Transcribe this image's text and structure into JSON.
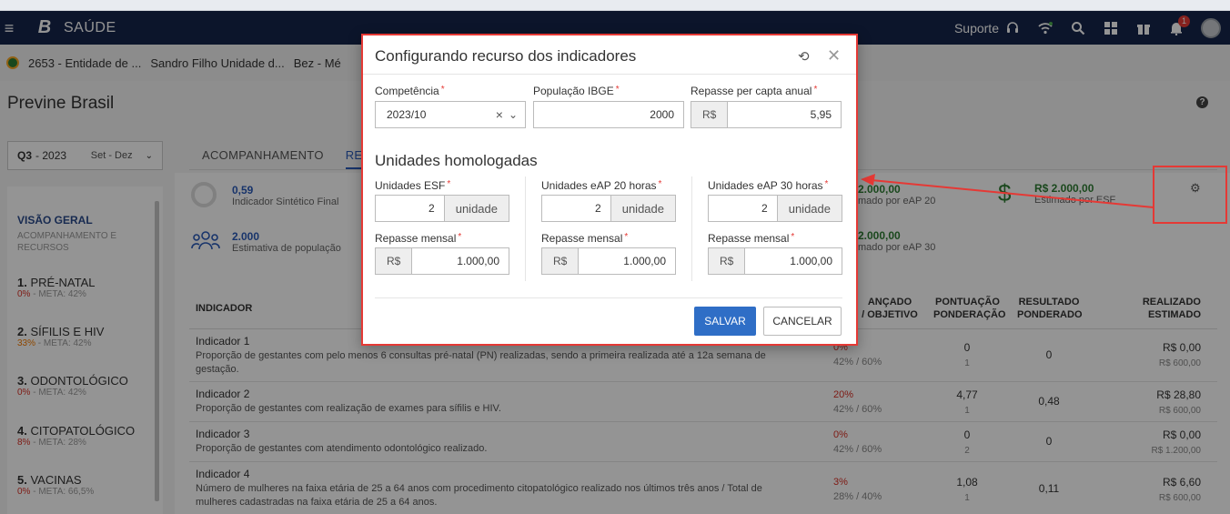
{
  "navbar": {
    "app_name": "SAÚDE",
    "support_label": "Suporte",
    "notification_count": "1"
  },
  "breadcrumb": {
    "entity": "2653 - Entidade de ...",
    "unit": "Sandro Filho Unidade d...",
    "extra": "Bez - Mé"
  },
  "page": {
    "title": "Previne Brasil"
  },
  "period": {
    "quarter": "Q3",
    "year": "- 2023",
    "range": "Set - Dez"
  },
  "sidenav": {
    "overview_title": "VISÃO GERAL",
    "overview_sub": "ACOMPANHAMENTO E RECURSOS",
    "items": [
      {
        "num": "1.",
        "label": "PRÉ-NATAL",
        "pct": "0%",
        "meta": " - META: 42%"
      },
      {
        "num": "2.",
        "label": "SÍFILIS E HIV",
        "pct": "33%",
        "meta": " - META: 42%"
      },
      {
        "num": "3.",
        "label": "ODONTOLÓGICO",
        "pct": "0%",
        "meta": " - META: 42%"
      },
      {
        "num": "4.",
        "label": "CITOPATOLÓGICO",
        "pct": "8%",
        "meta": " - META: 28%"
      },
      {
        "num": "5.",
        "label": "VACINAS",
        "pct": "0%",
        "meta": " - META: 66,5%"
      }
    ]
  },
  "tabs": [
    {
      "label": "ACOMPANHAMENTO"
    },
    {
      "label": "RECU"
    }
  ],
  "stats": {
    "isf_value": "0,59",
    "isf_label": "Indicador Sintético Final",
    "pop_value": "2.000",
    "pop_label": "Estimativa de população",
    "eap20_value": "2.000,00",
    "eap20_label": "mado por eAP 20",
    "eap30_value": "2.000,00",
    "eap30_label": "mado por eAP 30",
    "esf_value": "R$ 2.000,00",
    "esf_label": "Estimado por ESF"
  },
  "table": {
    "headers": {
      "indicador": "INDICADOR",
      "alcancado_1": "ANÇADO",
      "alcancado_2": "/ OBJETIVO",
      "pontuacao_1": "PONTUAÇÃO",
      "pontuacao_2": "PONDERAÇÃO",
      "resultado_1": "RESULTADO",
      "resultado_2": "PONDERADO",
      "realizado_1": "REALIZADO",
      "realizado_2": "ESTIMADO"
    },
    "rows": [
      {
        "name": "Indicador 1",
        "desc": "Proporção de gestantes com pelo menos 6 consultas pré-natal (PN) realizadas, sendo a primeira realizada até a 12a semana de gestação.",
        "pct": "0%",
        "obj": "42% / 60%",
        "pts": "0",
        "pond": "1",
        "res": "0",
        "real": "R$ 0,00",
        "est": "R$ 600,00"
      },
      {
        "name": "Indicador 2",
        "desc": "Proporção de gestantes com realização de exames para sífilis e HIV.",
        "pct": "20%",
        "obj": "42% / 60%",
        "pts": "4,77",
        "pond": "1",
        "res": "0,48",
        "real": "R$ 28,80",
        "est": "R$ 600,00"
      },
      {
        "name": "Indicador 3",
        "desc": "Proporção de gestantes com atendimento odontológico realizado.",
        "pct": "0%",
        "obj": "42% / 60%",
        "pts": "0",
        "pond": "2",
        "res": "0",
        "real": "R$ 0,00",
        "est": "R$ 1.200,00"
      },
      {
        "name": "Indicador 4",
        "desc": "Número de mulheres na faixa etária de 25 a 64 anos com procedimento citopatológico realizado nos últimos três anos / Total de mulheres cadastradas na faixa etária de 25 a 64 anos.",
        "pct": "3%",
        "obj": "28% / 40%",
        "pts": "1,08",
        "pond": "1",
        "res": "0,11",
        "real": "R$ 6,60",
        "est": "R$ 600,00"
      }
    ]
  },
  "modal": {
    "title": "Configurando recurso dos indicadores",
    "competencia_label": "Competência",
    "competencia_value": "2023/10",
    "competencia_clear": "×",
    "populacao_label": "População IBGE",
    "populacao_value": "2000",
    "repasse_capta_label": "Repasse per capta anual",
    "repasse_capta_prefix": "R$",
    "repasse_capta_value": "5,95",
    "section_title": "Unidades homologadas",
    "columns": [
      {
        "units_label": "Unidades ESF",
        "units_value": "2",
        "units_suffix": "unidade",
        "repasse_label": "Repasse mensal",
        "repasse_prefix": "R$",
        "repasse_value": "1.000,00"
      },
      {
        "units_label": "Unidades eAP 20 horas",
        "units_value": "2",
        "units_suffix": "unidade",
        "repasse_label": "Repasse mensal",
        "repasse_prefix": "R$",
        "repasse_value": "1.000,00"
      },
      {
        "units_label": "Unidades eAP 30 horas",
        "units_value": "2",
        "units_suffix": "unidade",
        "repasse_label": "Repasse mensal",
        "repasse_prefix": "R$",
        "repasse_value": "1.000,00"
      }
    ],
    "required_mark": "*",
    "save_label": "SALVAR",
    "cancel_label": "CANCELAR"
  },
  "colors": {
    "navbar": "#15254a",
    "accent": "#2f6ec6",
    "annotation": "#e53935",
    "positive": "#2e7d32"
  }
}
